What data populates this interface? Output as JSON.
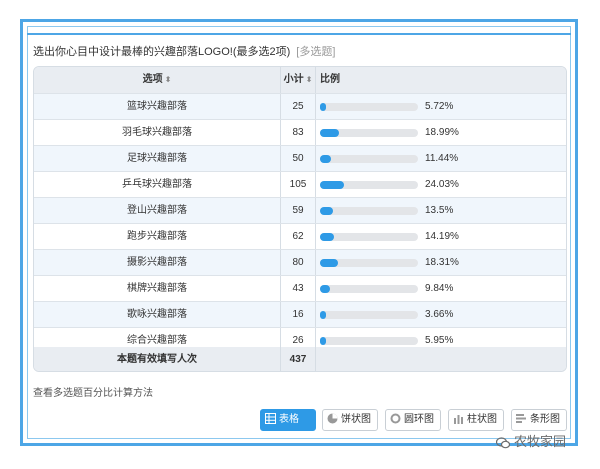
{
  "question": {
    "title": "选出你心目中设计最棒的兴趣部落LOGO!(最多选2项)",
    "type_tag": "[多选题]"
  },
  "table": {
    "headers": {
      "option": "选项",
      "count": "小计",
      "ratio": "比例"
    },
    "rows": [
      {
        "option": "篮球兴趣部落",
        "count": "25",
        "percent_text": "5.72%",
        "percent": 5.72
      },
      {
        "option": "羽毛球兴趣部落",
        "count": "83",
        "percent_text": "18.99%",
        "percent": 18.99
      },
      {
        "option": "足球兴趣部落",
        "count": "50",
        "percent_text": "11.44%",
        "percent": 11.44
      },
      {
        "option": "乒乓球兴趣部落",
        "count": "105",
        "percent_text": "24.03%",
        "percent": 24.03
      },
      {
        "option": "登山兴趣部落",
        "count": "59",
        "percent_text": "13.5%",
        "percent": 13.5
      },
      {
        "option": "跑步兴趣部落",
        "count": "62",
        "percent_text": "14.19%",
        "percent": 14.19
      },
      {
        "option": "摄影兴趣部落",
        "count": "80",
        "percent_text": "18.31%",
        "percent": 18.31
      },
      {
        "option": "棋牌兴趣部落",
        "count": "43",
        "percent_text": "9.84%",
        "percent": 9.84
      },
      {
        "option": "歌咏兴趣部落",
        "count": "16",
        "percent_text": "3.66%",
        "percent": 3.66
      },
      {
        "option": "综合兴趣部落",
        "count": "26",
        "percent_text": "5.95%",
        "percent": 5.95
      }
    ],
    "footer": {
      "label": "本题有效填写人次",
      "count": "437"
    }
  },
  "method_link": "查看多选题百分比计算方法",
  "view_buttons": {
    "table": "表格",
    "pie": "饼状图",
    "ring": "圆环图",
    "column": "柱状图",
    "bar": "条形图"
  },
  "watermark": "农牧家园",
  "colors": {
    "accent": "#2e9ae6",
    "frame": "#4da6e6",
    "header_bg": "#e9edf2",
    "alt_row_bg": "#f0f6fc",
    "bar_track": "#e3e5e8"
  }
}
